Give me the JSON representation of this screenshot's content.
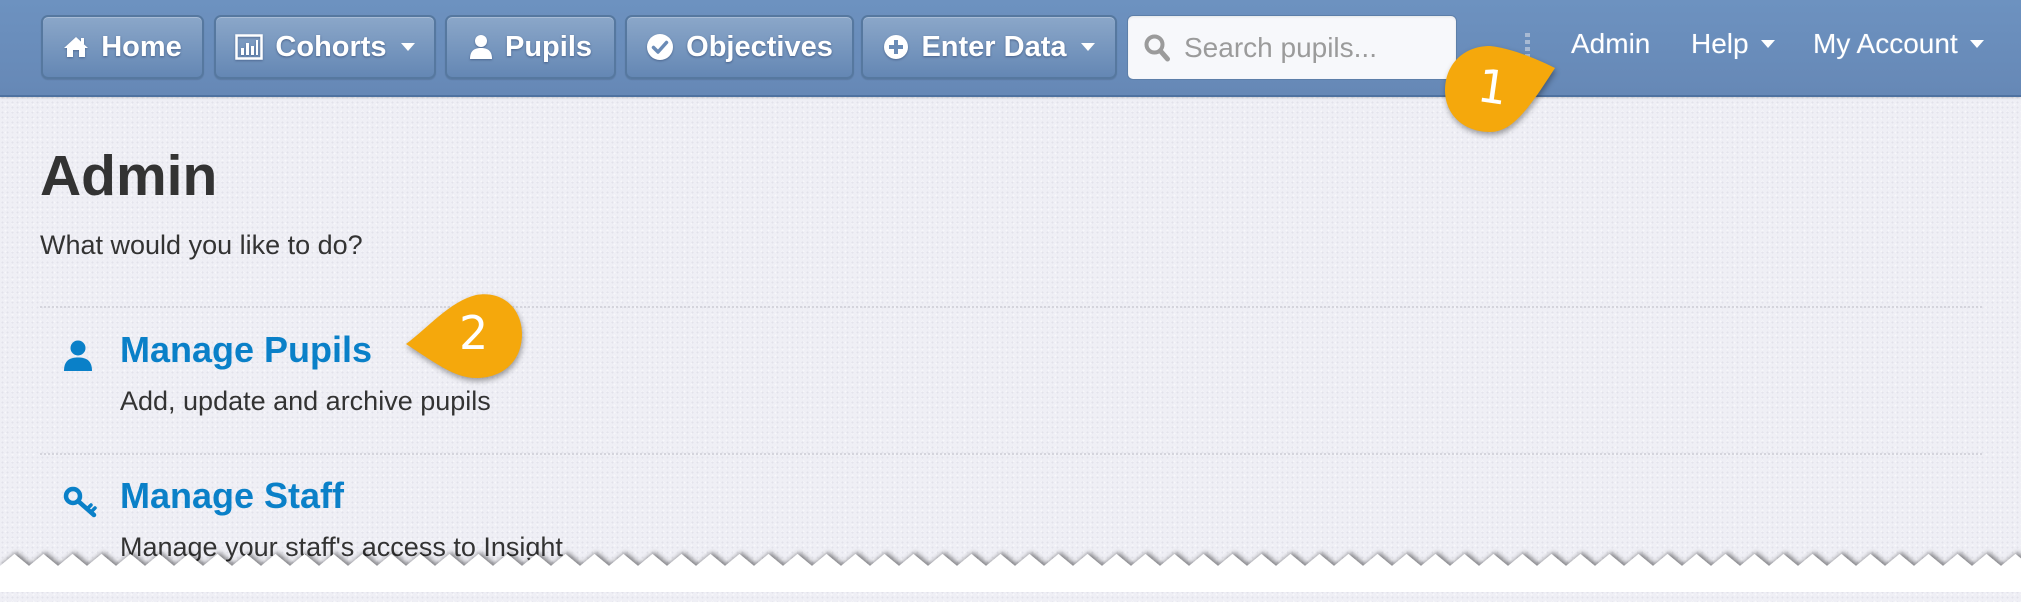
{
  "navbar": {
    "buttons": [
      {
        "label": "Home",
        "icon": "home-icon",
        "has_dropdown": false
      },
      {
        "label": "Cohorts",
        "icon": "bar-chart-icon",
        "has_dropdown": true
      },
      {
        "label": "Pupils",
        "icon": "user-icon",
        "has_dropdown": false
      },
      {
        "label": "Objectives",
        "icon": "check-circle-icon",
        "has_dropdown": false
      },
      {
        "label": "Enter Data",
        "icon": "plus-circle-icon",
        "has_dropdown": true
      }
    ],
    "search": {
      "placeholder": "Search pupils...",
      "value": ""
    },
    "links": [
      {
        "label": "Admin",
        "has_dropdown": false
      },
      {
        "label": "Help",
        "has_dropdown": true
      },
      {
        "label": "My Account",
        "has_dropdown": true
      }
    ]
  },
  "main": {
    "title": "Admin",
    "subtitle": "What would you like to do?",
    "options": [
      {
        "title": "Manage Pupils",
        "description": "Add, update and archive pupils",
        "icon": "user-icon"
      },
      {
        "title": "Manage Staff",
        "description": "Manage your staff's access to Insight",
        "icon": "key-icon"
      }
    ]
  },
  "callouts": [
    {
      "number": "1",
      "target": "Admin"
    },
    {
      "number": "2",
      "target": "Manage Pupils"
    }
  ],
  "colors": {
    "navbar": "#6a8fbd",
    "link_blue": "#0a80c8",
    "callout": "#f5a80c",
    "background": "#efeff5"
  }
}
